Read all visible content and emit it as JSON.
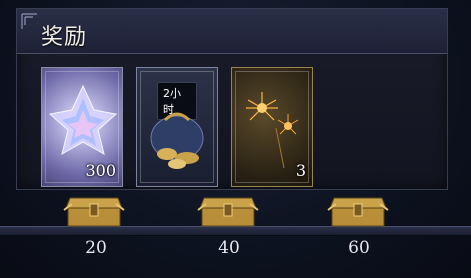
{
  "panel": {
    "title": "奖励"
  },
  "rewards": [
    {
      "name": "crystal-item",
      "quantity": "300",
      "badge": ""
    },
    {
      "name": "gold-sack-item",
      "quantity": "",
      "badge": "2小时"
    },
    {
      "name": "fireworks-item",
      "quantity": "3",
      "badge": ""
    }
  ],
  "milestones": [
    {
      "value": "20"
    },
    {
      "value": "40"
    },
    {
      "value": "60"
    }
  ],
  "colors": {
    "accent_gold": "#c9a24a",
    "panel_bg": "#161824"
  }
}
